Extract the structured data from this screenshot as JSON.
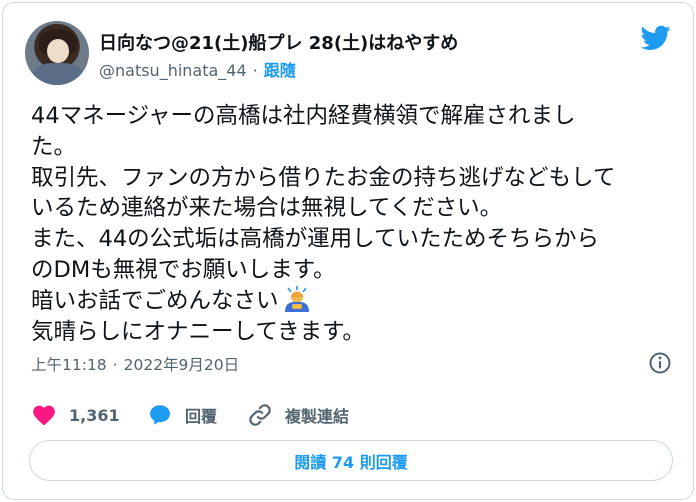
{
  "author": {
    "display_name": "日向なつ@21(土)船プレ 28(土)はねやすめ",
    "handle": "@natsu_hinata_44",
    "separator": "·",
    "follow_label": "跟隨"
  },
  "tweet": {
    "lines": [
      "44マネージャーの高橋は社内経費横領で解雇されまし",
      "た。",
      "取引先、ファンの方から借りたお金の持ち逃げなどもして",
      "いるため連絡が来た場合は無視してください。",
      "また、44の公式垢は高橋が運用していたためそちらから",
      "のDMも無視でお願いします。",
      "暗いお話でごめんなさい",
      "気晴らしにオナニーしてきます。"
    ],
    "emoji": "bowing-person-emoji"
  },
  "meta": {
    "time": "上午11:18",
    "separator": "·",
    "date": "2022年9月20日"
  },
  "actions": {
    "like_count": "1,361",
    "reply_label": "回覆",
    "copy_link_label": "複製連結"
  },
  "read_replies_label": "閱讀 74 則回覆",
  "colors": {
    "accent": "#1d9bf0",
    "like": "#f91880",
    "text": "#0f1419",
    "secondary": "#536471",
    "border": "#cfd9de"
  }
}
